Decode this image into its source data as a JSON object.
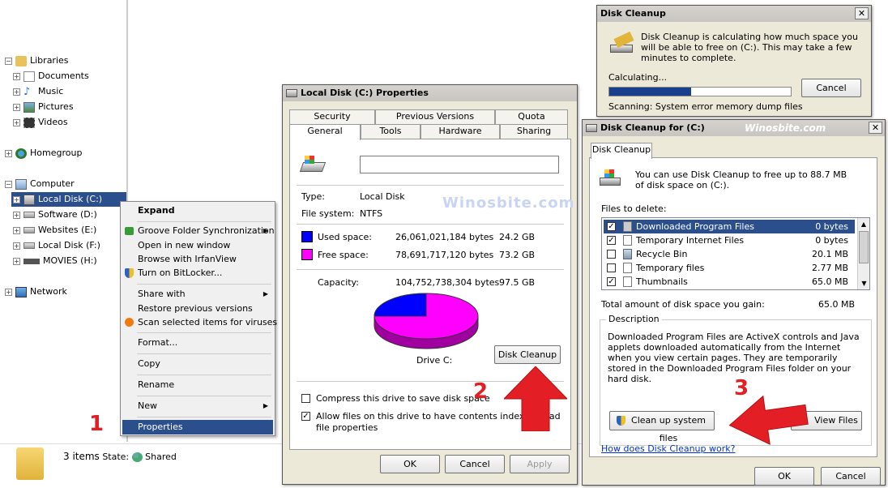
{
  "tree": {
    "libraries": "Libraries",
    "documents": "Documents",
    "music": "Music",
    "pictures": "Pictures",
    "videos": "Videos",
    "homegroup": "Homegroup",
    "computer": "Computer",
    "local_c": "Local Disk (C:)",
    "software_d": "Software (D:)",
    "websites_e": "Websites (E:)",
    "local_f": "Local Disk (F:)",
    "movies_h": "MOVIES (H:)",
    "network": "Network"
  },
  "status": {
    "items": "3 items",
    "state_label": "State:",
    "state_value": "Shared"
  },
  "menu": {
    "expand": "Expand",
    "groove": "Groove Folder Synchronization",
    "open_new": "Open in new window",
    "browse_irfan": "Browse with IrfanView",
    "bitlocker": "Turn on BitLocker...",
    "share_with": "Share with",
    "restore": "Restore previous versions",
    "scan": "Scan selected items for viruses",
    "format": "Format...",
    "copy": "Copy",
    "rename": "Rename",
    "new": "New",
    "properties": "Properties"
  },
  "props": {
    "title": "Local Disk (C:) Properties",
    "tabs": {
      "security": "Security",
      "previous": "Previous Versions",
      "quota": "Quota",
      "general": "General",
      "tools": "Tools",
      "hardware": "Hardware",
      "sharing": "Sharing"
    },
    "type_label": "Type:",
    "type_value": "Local Disk",
    "fs_label": "File system:",
    "fs_value": "NTFS",
    "used_label": "Used space:",
    "used_bytes": "26,061,021,184 bytes",
    "used_gb": "24.2 GB",
    "free_label": "Free space:",
    "free_bytes": "78,691,717,120 bytes",
    "free_gb": "73.2 GB",
    "cap_label": "Capacity:",
    "cap_bytes": "104,752,738,304 bytes",
    "cap_gb": "97.5 GB",
    "drive": "Drive C:",
    "disk_cleanup": "Disk Cleanup",
    "compress": "Compress this drive to save disk space",
    "index": "Allow files on this drive to have contents indexed in ad",
    "index2": "file properties",
    "ok": "OK",
    "cancel": "Cancel",
    "apply": "Apply",
    "used_fraction": 0.25,
    "used_color": "#0000ff",
    "free_color": "#ff00ff"
  },
  "calc": {
    "title": "Disk Cleanup",
    "message": "Disk Cleanup is calculating how much space you will be able to free on (C:). This may take a few minutes to complete.",
    "calculating": "Calculating...",
    "cancel": "Cancel",
    "scanning": "Scanning:  System error memory dump files",
    "progress": 0.45
  },
  "cleanup": {
    "title": "Disk Cleanup for  (C:)",
    "tab": "Disk Cleanup",
    "intro": "You can use Disk Cleanup to free up to 88.7 MB of disk space on  (C:).",
    "files_label": "Files to delete:",
    "files": [
      {
        "name": "Downloaded Program Files",
        "size": "0 bytes",
        "checked": true
      },
      {
        "name": "Temporary Internet Files",
        "size": "0 bytes",
        "checked": true
      },
      {
        "name": "Recycle Bin",
        "size": "20.1 MB",
        "checked": false
      },
      {
        "name": "Temporary files",
        "size": "2.77 MB",
        "checked": false
      },
      {
        "name": "Thumbnails",
        "size": "65.0 MB",
        "checked": true
      }
    ],
    "total_label": "Total amount of disk space you gain:",
    "total_value": "65.0 MB",
    "desc_label": "Description",
    "desc": "Downloaded Program Files are ActiveX controls and Java applets downloaded automatically from the Internet when you view certain pages. They are temporarily stored in the Downloaded Program Files folder on your hard disk.",
    "clean_sys": "Clean up system files",
    "view_files": "View Files",
    "how": "How does Disk Cleanup work?",
    "ok": "OK",
    "cancel": "Cancel"
  },
  "annotations": {
    "n1": "1",
    "n2": "2",
    "n3": "3",
    "watermark1": "Winosbite.com",
    "watermark2": "Winosbite.com",
    "arrow_color": "#e31e24"
  }
}
